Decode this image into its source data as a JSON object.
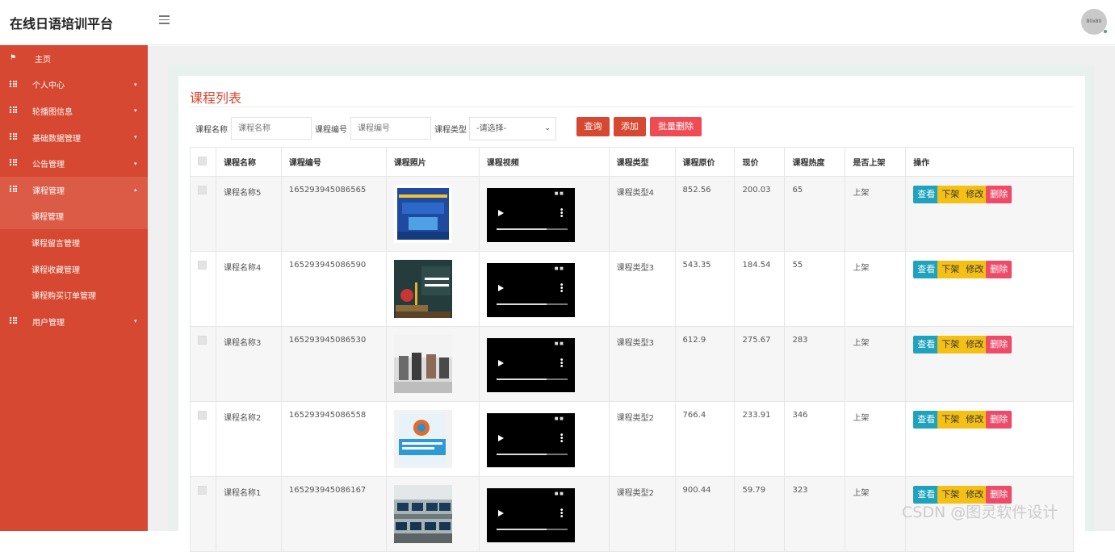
{
  "header": {
    "app_title": "在线日语培训平台",
    "avatar_text": "80x80"
  },
  "sidebar": {
    "items": [
      {
        "label": "主页"
      },
      {
        "label": "个人中心"
      },
      {
        "label": "轮播图信息"
      },
      {
        "label": "基础数据管理"
      },
      {
        "label": "公告管理"
      },
      {
        "label": "课程管理"
      },
      {
        "label": "用户管理"
      }
    ],
    "sub_items": [
      {
        "label": "课程管理"
      },
      {
        "label": "课程留言管理"
      },
      {
        "label": "课程收藏管理"
      },
      {
        "label": "课程购买订单管理"
      }
    ]
  },
  "main": {
    "title": "课程列表",
    "search": {
      "name_label": "课程名称",
      "name_placeholder": "课程名称",
      "code_label": "课程编号",
      "code_placeholder": "课程编号",
      "type_label": "课程类型",
      "type_selected": "-请选择-"
    },
    "buttons": {
      "query": "查询",
      "add": "添加",
      "batch_delete": "批量删除"
    },
    "table": {
      "headers": [
        "课程名称",
        "课程编号",
        "课程照片",
        "课程视频",
        "课程类型",
        "课程原价",
        "现价",
        "课程热度",
        "是否上架",
        "操作"
      ],
      "rows": [
        {
          "name": "课程名称5",
          "code": "165293945086565",
          "type": "课程类型4",
          "orig": "852.56",
          "price": "200.03",
          "heat": "65",
          "status": "上架"
        },
        {
          "name": "课程名称4",
          "code": "165293945086590",
          "type": "课程类型3",
          "orig": "543.35",
          "price": "184.54",
          "heat": "55",
          "status": "上架"
        },
        {
          "name": "课程名称3",
          "code": "165293945086530",
          "type": "课程类型3",
          "orig": "612.9",
          "price": "275.67",
          "heat": "283",
          "status": "上架"
        },
        {
          "name": "课程名称2",
          "code": "165293945086558",
          "type": "课程类型2",
          "orig": "766.4",
          "price": "233.91",
          "heat": "346",
          "status": "上架"
        },
        {
          "name": "课程名称1",
          "code": "165293945086167",
          "type": "课程类型2",
          "orig": "900.44",
          "price": "59.79",
          "heat": "323",
          "status": "上架"
        }
      ],
      "actions": {
        "view": "查看",
        "off": "下架",
        "edit": "修改",
        "delete": "删除"
      }
    }
  },
  "watermark": "CSDN @图灵软件设计",
  "colors": {
    "sidebar": "#d64831",
    "view": "#1ea2bd",
    "warn": "#f5c014",
    "danger": "#ee4b69"
  }
}
